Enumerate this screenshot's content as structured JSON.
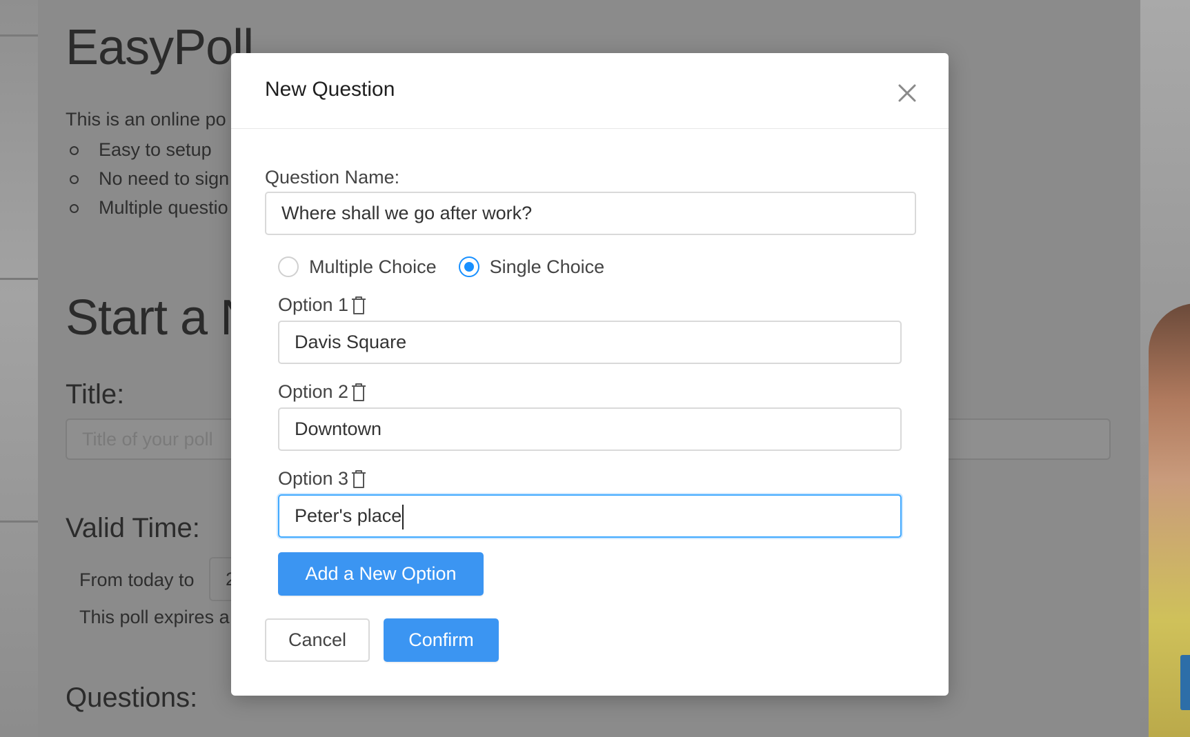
{
  "background_page": {
    "app_title": "EasyPoll",
    "intro_text": "This is an online po",
    "features": [
      "Easy to setup",
      "No need to sign",
      "Multiple questio"
    ],
    "section_title": "Start a N",
    "title_label": "Title:",
    "title_placeholder": "Title of your poll",
    "valid_time_label": "Valid Time:",
    "from_today_text": "From today to",
    "date_value": "2",
    "expires_text": "This poll expires a",
    "questions_label": "Questions:"
  },
  "modal": {
    "title": "New Question",
    "close_icon": "close-icon",
    "question_name_label": "Question Name:",
    "question_name_value": "Where shall we go after work?",
    "choice_types": [
      {
        "label": "Multiple Choice",
        "checked": false
      },
      {
        "label": "Single Choice",
        "checked": true
      }
    ],
    "options": [
      {
        "label": "Option 1",
        "value": "Davis Square",
        "focused": false
      },
      {
        "label": "Option 2",
        "value": "Downtown",
        "focused": false
      },
      {
        "label": "Option 3",
        "value": "Peter's place",
        "focused": true
      }
    ],
    "add_option_label": "Add a New Option",
    "cancel_label": "Cancel",
    "confirm_label": "Confirm",
    "trash_icon": "trash-icon"
  },
  "colors": {
    "primary": "#3b95f2",
    "radio_checked": "#1890ff",
    "focus_border": "#40a9ff",
    "overlay": "#8b8b8b"
  }
}
